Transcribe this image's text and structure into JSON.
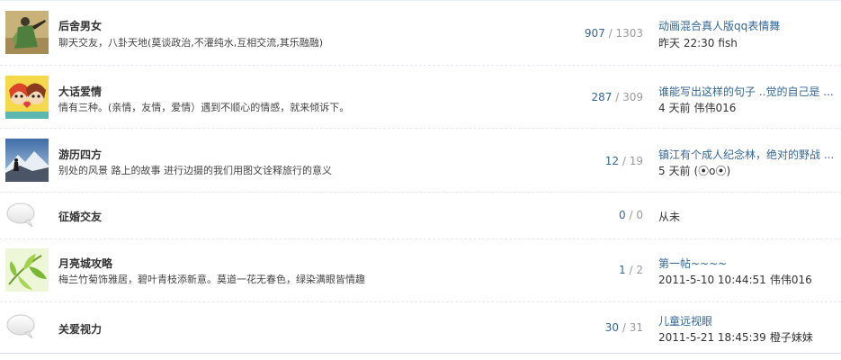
{
  "forums": [
    {
      "name": "后舍男女",
      "description": "聊天交友，八卦天地(莫谈政治,不灌纯水,互相交流,其乐融融)",
      "icon": "warrior-thumbnail-icon",
      "threads": "907",
      "separator": "/",
      "posts": "1303",
      "last_title": "动画混合真人版qq表情舞",
      "last_time": "昨天 22:30",
      "last_user": "fish"
    },
    {
      "name": "大话爱情",
      "description": "情有三种。(亲情，友情，爱情）遇到不顺心的情感，就来倾诉下。",
      "icon": "cartoon-couple-thumbnail-icon",
      "threads": "287",
      "separator": "/",
      "posts": "309",
      "last_title": "谁能写出这样的句子 ..觉的自己是 ...",
      "last_time": "4 天前",
      "last_user": "伟伟016"
    },
    {
      "name": "游历四方",
      "description": "别处的风景  路上的故事  进行边摄的我们用图文诠释旅行的意义",
      "icon": "mountain-hiker-thumbnail-icon",
      "threads": "12",
      "separator": "/",
      "posts": "19",
      "last_title": "镇江有个成人纪念林，绝对的野战 ...",
      "last_time": "5 天前",
      "last_user": "(⦿o⦿)"
    },
    {
      "name": "征婚交友",
      "description": "",
      "icon": "speech-bubble-icon",
      "threads": "0",
      "separator": "/",
      "posts": "0",
      "never_label": "从未"
    },
    {
      "name": "月亮城攻略",
      "description": "梅兰竹菊饰雅居，碧叶青枝添新意。莫道一花无春色，绿染满眼皆情趣",
      "icon": "bamboo-leaves-thumbnail-icon",
      "threads": "1",
      "separator": "/",
      "posts": "2",
      "last_title": "第一帖~~~~",
      "last_time": "2011-5-10 10:44:51",
      "last_user": "伟伟016"
    },
    {
      "name": "关爱视力",
      "description": "",
      "icon": "speech-bubble-icon",
      "threads": "30",
      "separator": "/",
      "posts": "31",
      "last_title": "儿童远视眼",
      "last_time": "2011-5-21 18:45:39",
      "last_user": "橙子妹妹"
    }
  ]
}
